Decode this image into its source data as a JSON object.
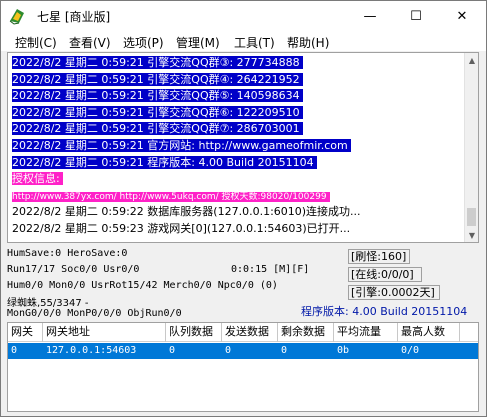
{
  "window": {
    "title": "七星 [商业版]",
    "controls": {
      "minimize": "—",
      "maximize": "☐",
      "close": "✕"
    }
  },
  "menu": [
    "控制(C)",
    "查看(V)",
    "选项(P)",
    "管理(M)",
    "工具(T)",
    "帮助(H)"
  ],
  "log": [
    {
      "text": "2022/8/2 星期二 0:59:21 引擎交流QQ群③: 277734888",
      "style": "sel"
    },
    {
      "text": "2022/8/2 星期二 0:59:21 引擎交流QQ群④: 264221952",
      "style": "sel"
    },
    {
      "text": "2022/8/2 星期二 0:59:21 引擎交流QQ群⑤: 140598634",
      "style": "sel"
    },
    {
      "text": "2022/8/2 星期二 0:59:21 引擎交流QQ群⑥: 122209510",
      "style": "sel"
    },
    {
      "text": "2022/8/2 星期二 0:59:21 引擎交流QQ群⑦: 286703001",
      "style": "sel"
    },
    {
      "text": "2022/8/2 星期二 0:59:21 官方网站: http://www.gameofmir.com",
      "style": "sel"
    },
    {
      "text": "2022/8/2 星期二 0:59:21 程序版本: 4.00 Build 20151104",
      "style": "sel"
    },
    {
      "text": "授权信息:",
      "style": "mag"
    },
    {
      "text": "http://www.387yx.com/ http://www.5ukq.com/ 授权天数:98020/100299",
      "style": "mag small"
    },
    {
      "text": "2022/8/2 星期二 0:59:22 数据库服务器(127.0.0.1:6010)连接成功...",
      "style": "normal"
    },
    {
      "text": "2022/8/2 星期二 0:59:23 游戏网关[0](127.0.0.1:54603)已打开...",
      "style": "normal"
    }
  ],
  "status": {
    "line1": "HumSave:0 HeroSave:0",
    "line2a": "Run17/17 Soc0/0 Usr0/0",
    "timer": "0:0:15 [M][F]",
    "line3": "Hum0/0 Mon0/0 UsrRot15/42 Merch0/0 Npc0/0 (0)",
    "line4": "绿蜘蛛,55/3347 -",
    "line5": "MonG0/0/0 MonP0/0/0 ObjRun0/0",
    "refresh": "[刷怪:160]",
    "online": "[在线:0/0/0]",
    "engine": "[引擎:0.0002天]",
    "version": "程序版本: 4.00 Build 20151104"
  },
  "table": {
    "columns": [
      "网关",
      "网关地址",
      "队列数据",
      "发送数据",
      "剩余数据",
      "平均流量",
      "最高人数"
    ],
    "rows": [
      [
        "0",
        "127.0.0.1:54603",
        "0",
        "0",
        "0",
        "0b",
        "0/0"
      ]
    ]
  },
  "colors": {
    "selection": "#0000c8",
    "highlight": "#ff21c8",
    "row_selected": "#0078d7",
    "version_text": "#0018a8"
  },
  "icons": {
    "app": "seven-star-logo-icon",
    "scroll_up": "▲",
    "scroll_down": "▼"
  }
}
